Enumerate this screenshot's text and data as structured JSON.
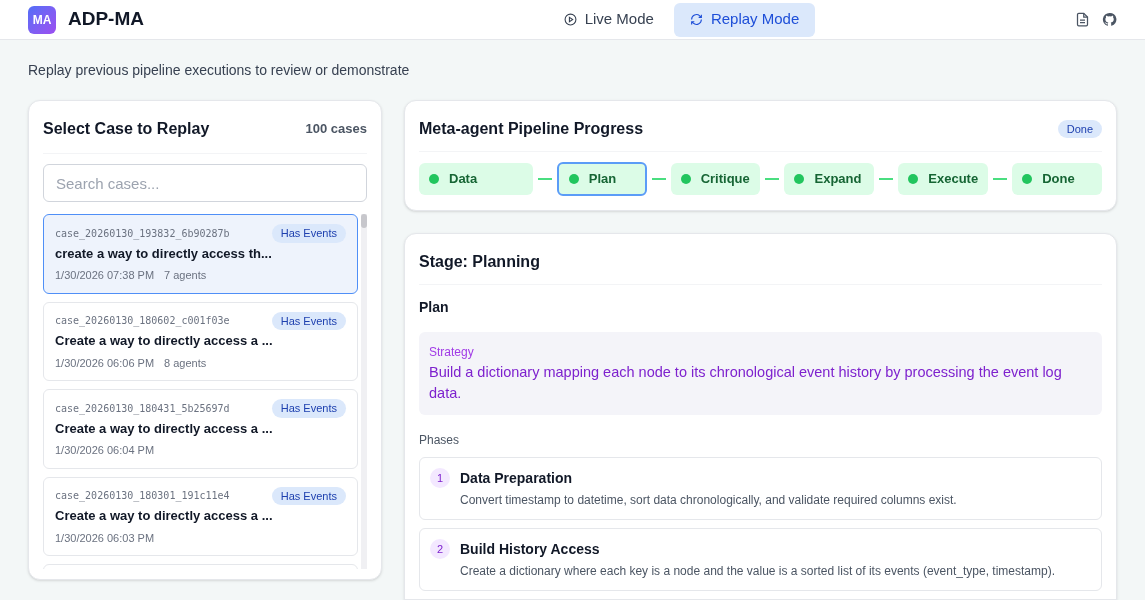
{
  "app": {
    "logo": "MA",
    "name": "ADP-MA"
  },
  "modes": [
    {
      "label": "Live Mode",
      "kind": "live",
      "selected": false
    },
    {
      "label": "Replay Mode",
      "kind": "replay",
      "selected": true
    }
  ],
  "subtitle": "Replay previous pipeline executions to review or demonstrate",
  "case_panel": {
    "title": "Select Case to Replay",
    "count": "100 cases",
    "search": {
      "placeholder": "Search cases..."
    },
    "cases": [
      {
        "id": "case_20260130_193832_6b90287b",
        "badge": "Has Events",
        "title": "create a way to directly access th...",
        "date": "1/30/2026 07:38 PM",
        "agents": "7 agents",
        "selected": true
      },
      {
        "id": "case_20260130_180602_c001f03e",
        "badge": "Has Events",
        "title": "Create a way to directly access a ...",
        "date": "1/30/2026 06:06 PM",
        "agents": "8 agents",
        "selected": false
      },
      {
        "id": "case_20260130_180431_5b25697d",
        "badge": "Has Events",
        "title": "Create a way to directly access a ...",
        "date": "1/30/2026 06:04 PM",
        "selected": false
      },
      {
        "id": "case_20260130_180301_191c11e4",
        "badge": "Has Events",
        "title": "Create a way to directly access a ...",
        "date": "1/30/2026 06:03 PM",
        "selected": false
      }
    ]
  },
  "pipeline": {
    "title": "Meta-agent Pipeline Progress",
    "status": "Done",
    "stages": [
      {
        "label": "Data",
        "selected": false
      },
      {
        "label": "Plan",
        "selected": true
      },
      {
        "label": "Critique",
        "selected": false
      },
      {
        "label": "Expand",
        "selected": false
      },
      {
        "label": "Execute",
        "selected": false
      },
      {
        "label": "Done",
        "selected": false
      }
    ]
  },
  "stage_panel": {
    "title": "Stage: Planning",
    "section": "Plan",
    "strategy_label": "Strategy",
    "strategy": "Build a dictionary mapping each node to its chronological event history by processing the event log data.",
    "phases_label": "Phases",
    "phases": [
      {
        "number": "1",
        "title": "Data Preparation",
        "description": "Convert timestamp to datetime, sort data chronologically, and validate required columns exist."
      },
      {
        "number": "2",
        "title": "Build History Access",
        "description": "Create a dictionary where each key is a node and the value is a sorted list of its events (event_type, timestamp)."
      }
    ]
  }
}
